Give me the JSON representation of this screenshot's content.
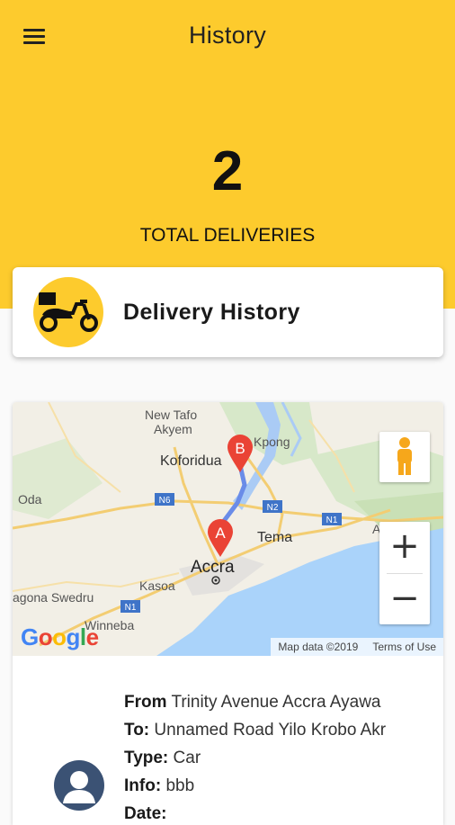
{
  "app": {
    "title": "History",
    "accent_color": "#fdcb2d"
  },
  "stats": {
    "total": "2",
    "total_label": "TOTAL DELIVERIES"
  },
  "history_card": {
    "label": "Delivery History",
    "icon": "delivery-scooter-icon"
  },
  "map": {
    "places": [
      "New Tafo",
      "Akyem",
      "Koforidua",
      "Kpong",
      "Oda",
      "Tema",
      "Accra",
      "Kasoa",
      "agona Swedru",
      "Winneba",
      "A"
    ],
    "roads": [
      "N6",
      "N2",
      "N1",
      "N1"
    ],
    "markers": [
      "A",
      "B"
    ],
    "attribution": "Map data ©2019",
    "terms": "Terms of Use",
    "logo": "Google",
    "zoom_in": "+",
    "zoom_out": "−"
  },
  "delivery": {
    "from_label": "From",
    "from_value": "Trinity Avenue Accra Ayawa",
    "to_label": "To:",
    "to_value": "Unnamed Road Yilo Krobo Akr",
    "type_label": "Type:",
    "type_value": "Car",
    "info_label": "Info:",
    "info_value": "bbb",
    "date_label": "Date:"
  }
}
